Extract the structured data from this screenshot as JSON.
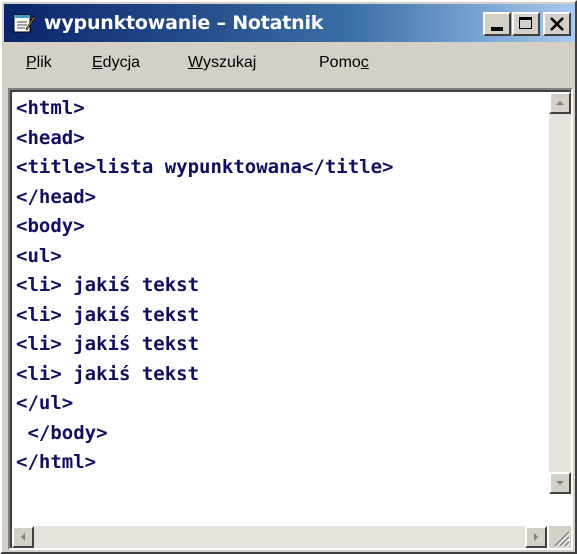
{
  "window": {
    "title": "wypunktowanie – Notatnik",
    "icon": "notepad-icon"
  },
  "menu": {
    "plik": {
      "pre": "",
      "u": "P",
      "post": "lik"
    },
    "edycja": {
      "pre": "",
      "u": "E",
      "post": "dycja"
    },
    "wyszukaj": {
      "pre": "",
      "u": "W",
      "post": "yszukaj"
    },
    "pomoc": {
      "pre": "Pomo",
      "u": "c",
      "post": ""
    }
  },
  "editor": {
    "content": "<html>\n<head>\n<title>lista wypunktowana</title>\n</head>\n<body>\n<ul>\n<li> jakiś tekst\n<li> jakiś tekst\n<li> jakiś tekst\n<li> jakiś tekst\n</ul>\n </body>\n</html>"
  },
  "colors": {
    "titlebar_start": "#0a246a",
    "titlebar_end": "#a6caf0",
    "text": "#101060",
    "chrome": "#d4d0c8"
  }
}
